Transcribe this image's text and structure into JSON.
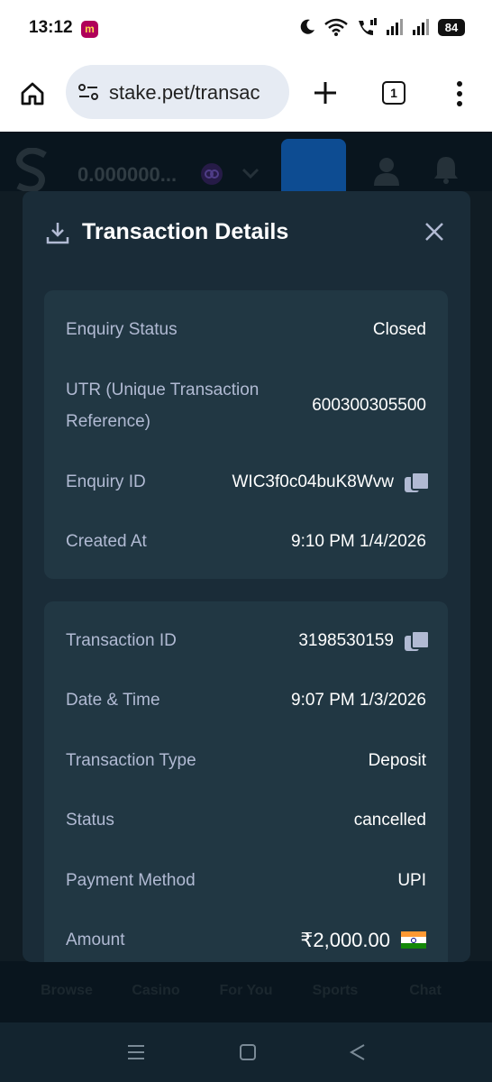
{
  "status_bar": {
    "time": "13:12",
    "app_badge": "m",
    "battery": "84"
  },
  "browser": {
    "url": "stake.pet/transac",
    "tab_count": "1"
  },
  "site": {
    "balance": "0.000000..."
  },
  "bottom_nav": {
    "items": [
      "Browse",
      "Casino",
      "For You",
      "Sports",
      "Chat"
    ]
  },
  "modal": {
    "title": "Transaction Details",
    "enquiry": {
      "status_label": "Enquiry Status",
      "status_value": "Closed",
      "utr_label": "UTR (Unique Transaction Reference)",
      "utr_value": "600300305500",
      "id_label": "Enquiry ID",
      "id_value": "WIC3f0c04buK8Wvw",
      "created_label": "Created At",
      "created_value": "9:10 PM 1/4/2026"
    },
    "transaction": {
      "id_label": "Transaction ID",
      "id_value": "3198530159",
      "datetime_label": "Date & Time",
      "datetime_value": "9:07 PM 1/3/2026",
      "type_label": "Transaction Type",
      "type_value": "Deposit",
      "status_label": "Status",
      "status_value": "cancelled",
      "method_label": "Payment Method",
      "method_value": "UPI",
      "amount_label": "Amount",
      "amount_value": "₹2,000.00"
    }
  },
  "colors": {
    "modal_bg": "#1a2c38",
    "card_bg": "#213743",
    "label": "#b1bad3",
    "accent_blue": "#1475e1"
  }
}
